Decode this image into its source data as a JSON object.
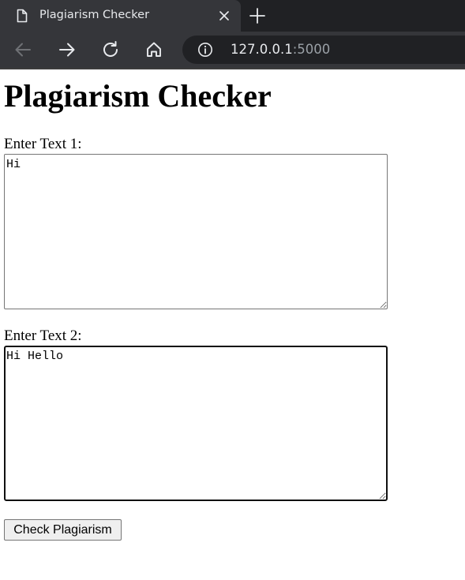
{
  "browser": {
    "tab": {
      "title": "Plagiarism Checker",
      "icon": "document-icon",
      "close_icon": "close-icon"
    },
    "new_tab_icon": "plus-icon",
    "nav": {
      "back_icon": "back-arrow-icon",
      "forward_icon": "forward-arrow-icon",
      "reload_icon": "reload-icon",
      "home_icon": "home-icon"
    },
    "address_bar": {
      "info_icon": "info-icon",
      "host": "127.0.0.1",
      "port": ":5000"
    }
  },
  "page": {
    "title": "Plagiarism Checker",
    "form": {
      "text1_label": "Enter Text 1:",
      "text1_value": "Hi",
      "text2_label": "Enter Text 2:",
      "text2_value": "Hi Hello",
      "submit_label": "Check Plagiarism"
    }
  },
  "colors": {
    "tabbar_bg": "#202124",
    "toolbar_bg": "#35363a",
    "omnibox_bg": "#202124",
    "chrome_text": "#e8eaed",
    "chrome_text_dim": "#9aa0a6"
  }
}
